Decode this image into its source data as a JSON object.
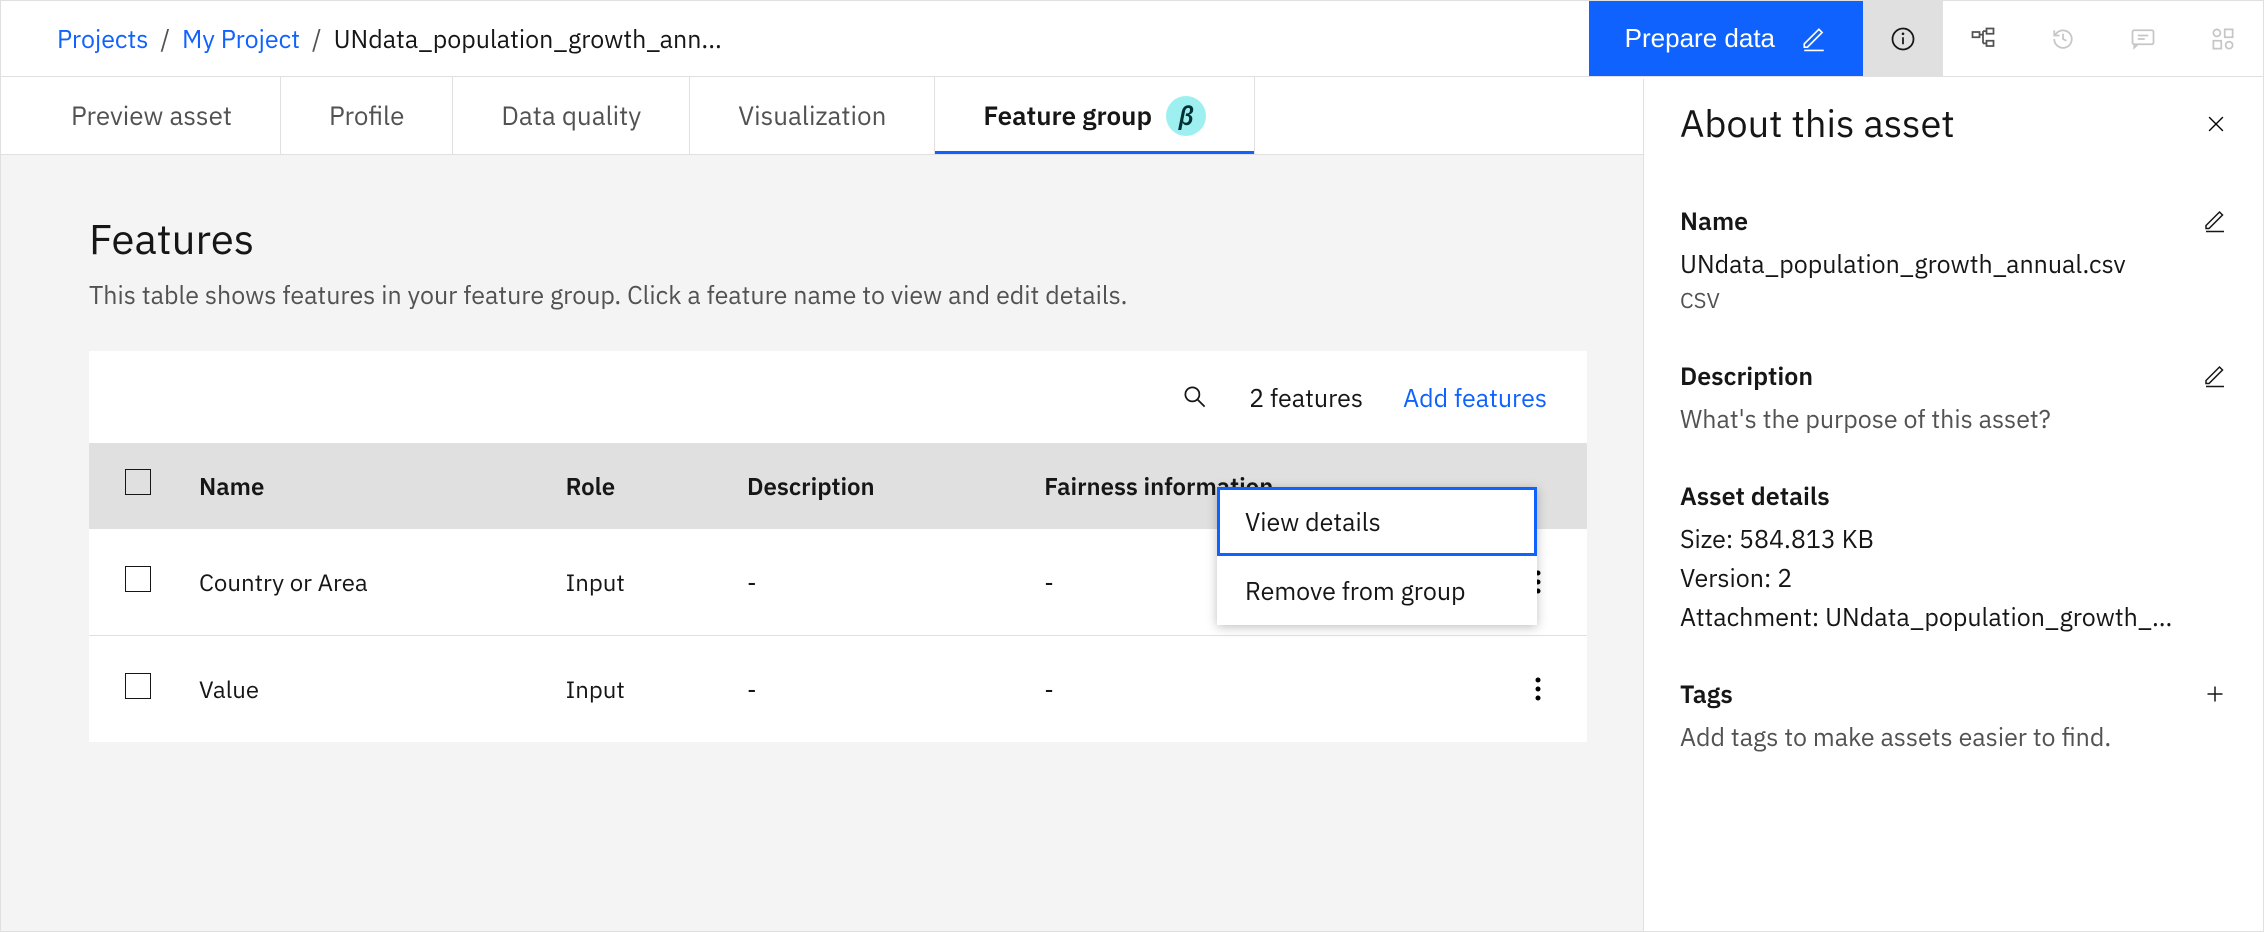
{
  "breadcrumb": {
    "root": "Projects",
    "project": "My Project",
    "asset": "UNdata_population_growth_ann..."
  },
  "actions": {
    "prepare": "Prepare data"
  },
  "tabs": [
    {
      "label": "Preview asset"
    },
    {
      "label": "Profile"
    },
    {
      "label": "Data quality"
    },
    {
      "label": "Visualization"
    },
    {
      "label": "Feature group",
      "active": true,
      "beta": "β"
    }
  ],
  "features": {
    "heading": "Features",
    "subtitle": "This table shows features in your feature group. Click a feature name to view and edit details.",
    "count_text": "2 features",
    "add_text": "Add features",
    "columns": {
      "name": "Name",
      "role": "Role",
      "description": "Description",
      "fairness": "Fairness information"
    },
    "rows": [
      {
        "name": "Country or Area",
        "role": "Input",
        "description": "-",
        "fairness": "-"
      },
      {
        "name": "Value",
        "role": "Input",
        "description": "-",
        "fairness": "-"
      }
    ]
  },
  "context_menu": {
    "view": "View details",
    "remove": "Remove from group"
  },
  "panel": {
    "title": "About this asset",
    "name_label": "Name",
    "name_value": "UNdata_population_growth_annual.csv",
    "name_type": "CSV",
    "desc_label": "Description",
    "desc_placeholder": "What's the purpose of this asset?",
    "details_label": "Asset details",
    "size": "Size: 584.813 KB",
    "version": "Version: 2",
    "attachment": "Attachment: UNdata_population_growth_...",
    "tags_label": "Tags",
    "tags_placeholder": "Add tags to make assets easier to find."
  }
}
